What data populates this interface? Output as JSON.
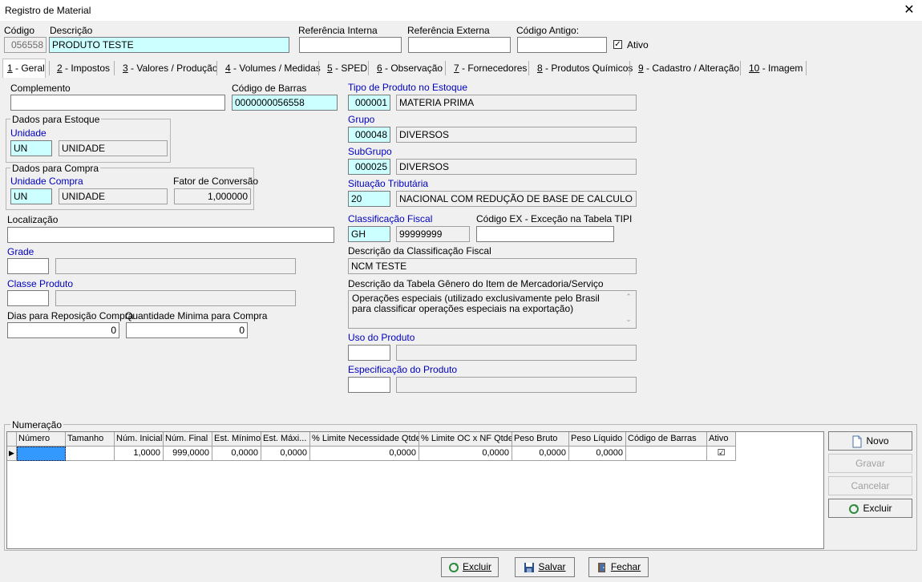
{
  "window": {
    "title": "Registro de Material",
    "close_glyph": "✕"
  },
  "header": {
    "codigo_label": "Código",
    "codigo_value": "056558",
    "descricao_label": "Descrição",
    "descricao_value": "PRODUTO TESTE",
    "ref_interna_label": "Referência Interna",
    "ref_interna_value": "",
    "ref_externa_label": "Referência Externa",
    "ref_externa_value": "",
    "codigo_antigo_label": "Código Antigo:",
    "codigo_antigo_value": "",
    "ativo_label": "Ativo",
    "ativo_checked": true
  },
  "tabs": [
    {
      "num": "1",
      "label": " - Geral"
    },
    {
      "num": "2",
      "label": " - Impostos"
    },
    {
      "num": "3",
      "label": " - Valores / Produção"
    },
    {
      "num": "4",
      "label": " - Volumes / Medidas"
    },
    {
      "num": "5",
      "label": " - SPED"
    },
    {
      "num": "6",
      "label": " - Observação"
    },
    {
      "num": "7",
      "label": " - Fornecedores"
    },
    {
      "num": "8",
      "label": " - Produtos Químicos"
    },
    {
      "num": "9",
      "label": " - Cadastro / Alteração"
    },
    {
      "num": "10",
      "label": " - Imagem"
    }
  ],
  "left": {
    "complemento_label": "Complemento",
    "complemento_value": "",
    "codigo_barras_label": "Código de Barras",
    "codigo_barras_value": "0000000056558",
    "estoque_group": "Dados para Estoque",
    "unidade_label": "Unidade",
    "unidade_code": "UN",
    "unidade_desc": "UNIDADE",
    "compra_group": "Dados para Compra",
    "unidade_compra_label": "Unidade Compra",
    "unidade_compra_code": "UN",
    "unidade_compra_desc": "UNIDADE",
    "fator_label": "Fator de Conversão",
    "fator_value": "1,000000",
    "localizacao_label": "Localização",
    "localizacao_value": "",
    "grade_label": "Grade",
    "classe_label": "Classe Produto",
    "dias_label": "Dias para Reposição Compra",
    "dias_value": "0",
    "qtd_min_label": "Quantidade Minima para Compra",
    "qtd_min_value": "0"
  },
  "right": {
    "tipo_label": "Tipo de Produto no Estoque",
    "tipo_code": "000001",
    "tipo_desc": "MATERIA PRIMA",
    "grupo_label": "Grupo",
    "grupo_code": "000048",
    "grupo_desc": "DIVERSOS",
    "subgrupo_label": "SubGrupo",
    "subgrupo_code": "000025",
    "subgrupo_desc": "DIVERSOS",
    "situacao_label": "Situação Tributária",
    "situacao_code": "20",
    "situacao_desc": "NACIONAL COM REDUÇÃO DE BASE DE CALCULO",
    "class_fiscal_label": "Classificação Fiscal",
    "class_fiscal_code": "GH",
    "class_fiscal_value": "99999999",
    "codigo_ex_label": "Código EX - Exceção na Tabela TIPI",
    "codigo_ex_value": "",
    "desc_class_label": "Descrição da Classificação Fiscal",
    "desc_class_value": "NCM TESTE",
    "desc_genero_label": "Descrição da Tabela Gênero do Item de Mercadoria/Serviço",
    "desc_genero_value": "Operações especiais (utilizado exclusivamente pelo Brasil para classificar operações especiais na exportação)",
    "uso_label": "Uso do Produto",
    "espec_label": "Especificação do Produto"
  },
  "numeracao": {
    "group": "Numeração",
    "columns": [
      "Número",
      "Tamanho",
      "Núm. Inicial",
      "Núm. Final",
      "Est. Mínimo",
      "Est. Máxi...",
      "% Limite Necessidade Qtde",
      "% Limite OC x NF Qtde",
      "Peso Bruto",
      "Peso Líquido",
      "Código de Barras",
      "Ativo"
    ],
    "row": [
      "",
      "",
      "1,0000",
      "999,0000",
      "0,0000",
      "0,0000",
      "0,0000",
      "0,0000",
      "0,0000",
      "0,0000",
      "",
      "☑"
    ],
    "buttons": {
      "novo": "Novo",
      "gravar": "Gravar",
      "cancelar": "Cancelar",
      "excluir": "Excluir"
    }
  },
  "footer": {
    "excluir": "Excluir",
    "salvar": "Salvar",
    "fechar": "Fechar"
  }
}
